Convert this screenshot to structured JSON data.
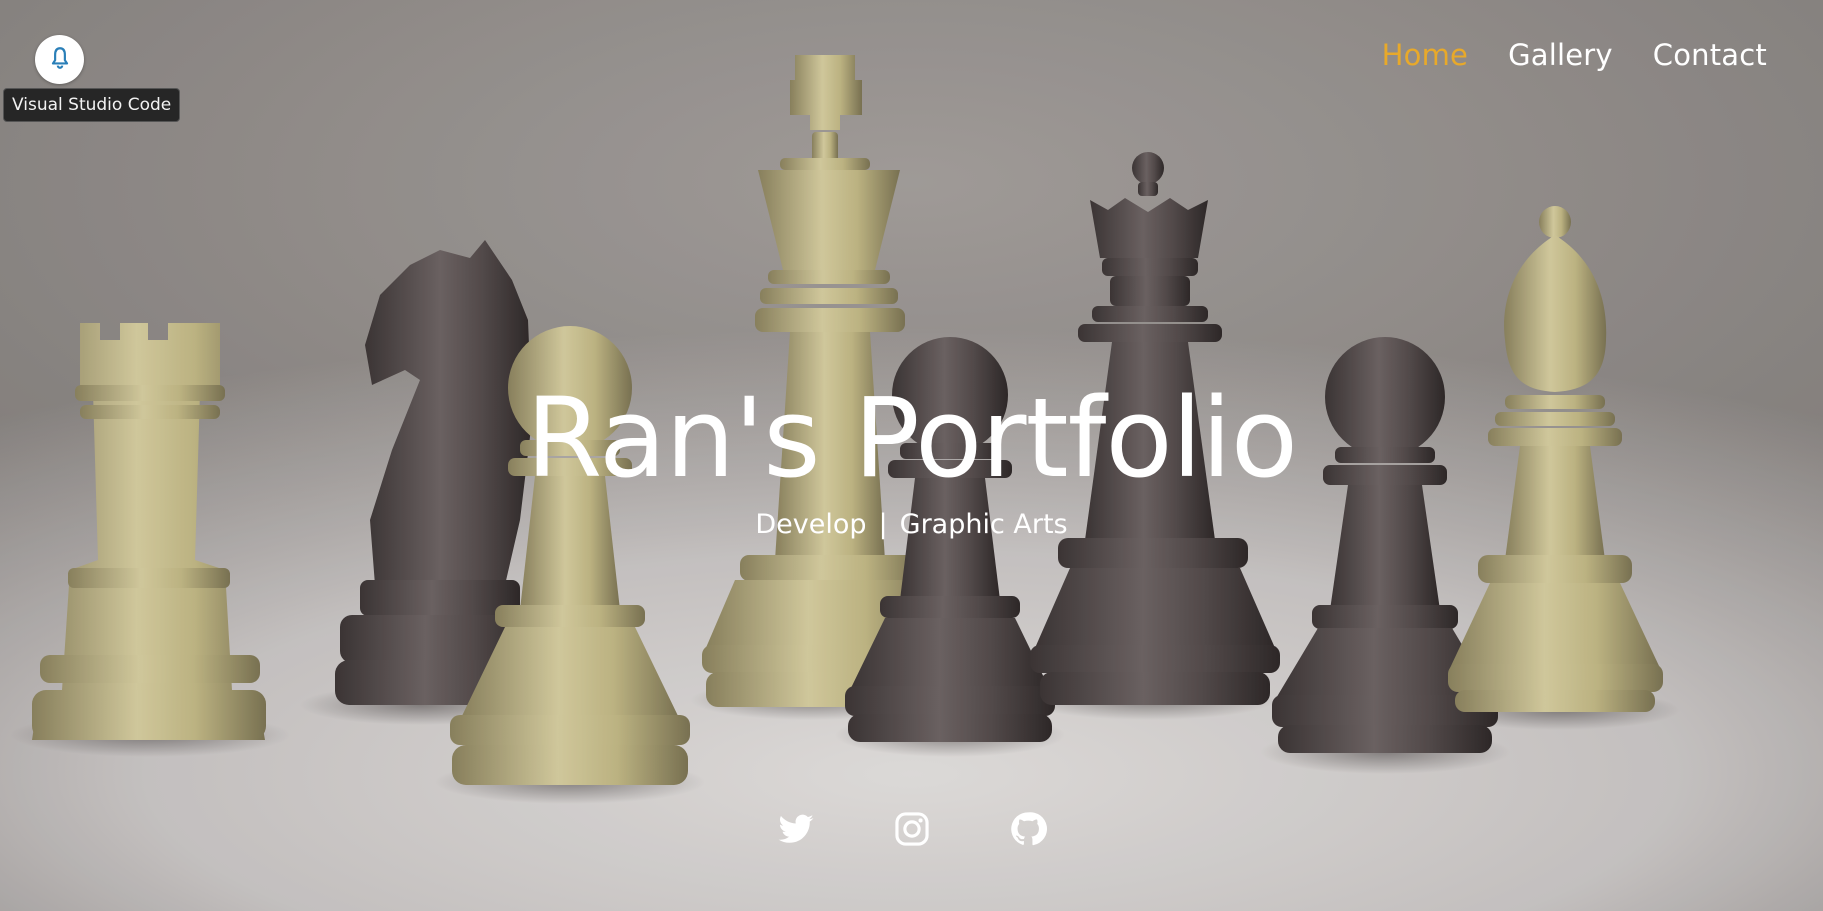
{
  "launcher": {
    "icon": "bell-icon",
    "tooltip": "Visual Studio Code"
  },
  "nav": {
    "items": [
      {
        "label": "Home",
        "active": true
      },
      {
        "label": "Gallery",
        "active": false
      },
      {
        "label": "Contact",
        "active": false
      }
    ],
    "active_color": "#e8a92a"
  },
  "hero": {
    "title": "Ran's Portfolio",
    "subtitle_left": "Develop",
    "subtitle_separator": "|",
    "subtitle_right": "Graphic Arts"
  },
  "social": [
    {
      "icon": "twitter-icon"
    },
    {
      "icon": "instagram-icon"
    },
    {
      "icon": "github-icon"
    }
  ]
}
